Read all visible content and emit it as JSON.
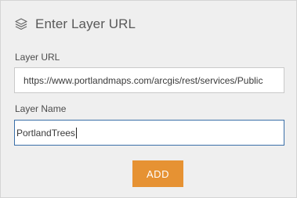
{
  "dialog": {
    "title": "Enter Layer URL",
    "icon": "layers-icon"
  },
  "fields": {
    "layer_url": {
      "label": "Layer URL",
      "value": "https://www.portlandmaps.com/arcgis/rest/services/Public"
    },
    "layer_name": {
      "label": "Layer Name",
      "value": "PortlandTrees"
    }
  },
  "actions": {
    "add_label": "ADD"
  },
  "colors": {
    "panel_bg": "#efefef",
    "accent_button": "#e69233",
    "focus_border": "#3a6fa8"
  }
}
